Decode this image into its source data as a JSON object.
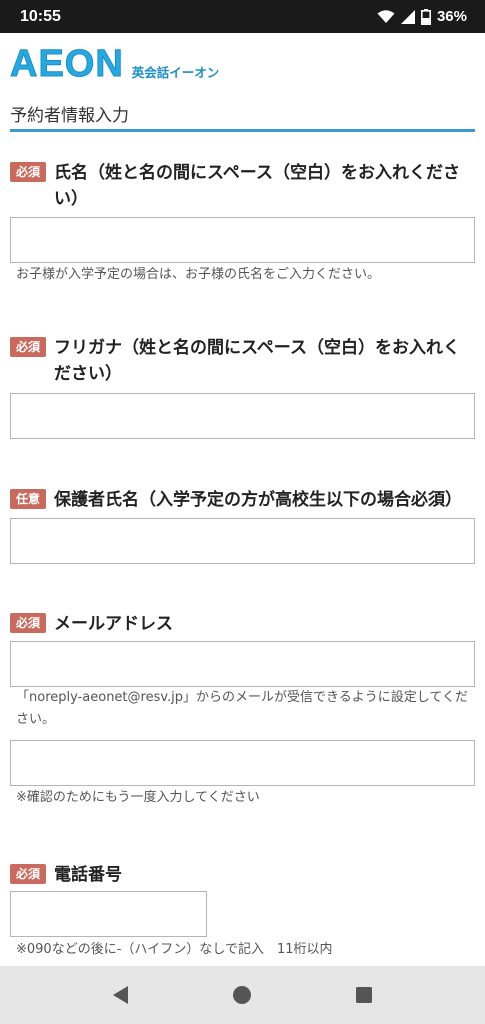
{
  "status": {
    "time": "10:55",
    "battery": "36%"
  },
  "brand": {
    "logo": "AEON",
    "subtitle": "英会話イーオン"
  },
  "page_title": "予約者情報入力",
  "fields": [
    {
      "badge": "必須",
      "label": "氏名（姓と名の間にスペース（空白）をお入れください）",
      "value": "",
      "note": "お子様が入学予定の場合は、お子様の氏名をご入力ください。"
    },
    {
      "badge": "必須",
      "label": "フリガナ（姓と名の間にスペース（空白）をお入れください）",
      "value": ""
    },
    {
      "badge": "任意",
      "label": "保護者氏名（入学予定の方が高校生以下の場合必須）",
      "value": ""
    },
    {
      "badge": "必須",
      "label": "メールアドレス",
      "value": "",
      "note": "「noreply-aeonet@resv.jp」からのメールが受信できるように設定してください。",
      "confirm_value": "",
      "confirm_note": "※確認のためにもう一度入力してください"
    },
    {
      "badge": "必須",
      "label": "電話番号",
      "value": "",
      "note": "※090などの後に-（ハイフン）なしで記入　11桁以内"
    }
  ],
  "icons": {
    "wifi": "wifi-icon",
    "signal": "signal-icon",
    "battery": "battery-icon",
    "back": "back-triangle-icon",
    "home": "home-circle-icon",
    "recents": "recents-square-icon"
  }
}
